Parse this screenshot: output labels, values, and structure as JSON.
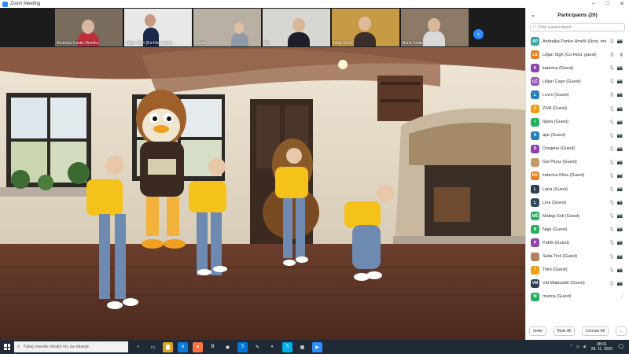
{
  "window": {
    "title": "Zoom Meeting",
    "controls": [
      "–",
      "□",
      "✕"
    ]
  },
  "gallery": {
    "tiles": [
      {
        "name": "Andrejka Fanko Hmelko"
      },
      {
        "name": "Lilijan Sigh (Ko-Host, gues..."
      },
      {
        "name": "Lumbi"
      },
      {
        "name": "Zia"
      },
      {
        "name": "Maja Skok"
      },
      {
        "name": "Boris Tovak"
      }
    ],
    "next_icon": "›"
  },
  "panel": {
    "title": "Participants (20)",
    "collapse_icon": "⌄",
    "search_placeholder": "Find a participant",
    "participants": [
      {
        "initials": "AP",
        "name": "Andrejka Panko Hmelk (Host, me)",
        "color": "#3aa39a",
        "mic": "🎙",
        "cam": "📷"
      },
      {
        "initials": "LS",
        "name": "Lilijan Sigh (Co-Host, guest)",
        "color": "#e67e22",
        "mic": "🎙",
        "cam": "▮"
      },
      {
        "initials": "K",
        "name": "katarina (Guest)",
        "color": "#8e44ad",
        "mic": "🎙",
        "cam": "📷"
      },
      {
        "initials": "LČ",
        "name": "Lilijan Čapo (Guest)",
        "color": "#9b59b6",
        "mic": "🎙",
        "cam": "📷"
      },
      {
        "initials": "L",
        "name": "Lovro (Guest)",
        "color": "#2980b9",
        "mic": "🎙",
        "cam": "📷"
      },
      {
        "initials": "Z",
        "name": "ZiVA (Guest)",
        "color": "#f39c12",
        "mic": "🎙",
        "cam": "📷"
      },
      {
        "initials": "I",
        "name": "Iljada (Guest)",
        "color": "#27ae60",
        "mic": "🎙",
        "cam": "📷"
      },
      {
        "initials": "A",
        "name": "ajar (Guest)",
        "color": "#2980b9",
        "mic": "🎙",
        "cam": "📷"
      },
      {
        "initials": "D",
        "name": "Dragana (Guest)",
        "color": "#8e44ad",
        "mic": "🎙",
        "cam": "📷"
      },
      {
        "initials": "",
        "name": "Gal Plunz (Guest)",
        "color": "#c49a6c",
        "mic": "🎙",
        "cam": "📷"
      },
      {
        "initials": "KK",
        "name": "katarina Kline (Guest)",
        "color": "#e67e22",
        "mic": "🎙",
        "cam": "📷"
      },
      {
        "initials": "L",
        "name": "Lana (Guest)",
        "color": "#2c3e50",
        "mic": "🎙",
        "cam": "📷"
      },
      {
        "initials": "L",
        "name": "Lina (Guest)",
        "color": "#34495e",
        "mic": "🎙",
        "cam": "📷"
      },
      {
        "initials": "MŠ",
        "name": "Mateja Šoli (Guest)",
        "color": "#27ae60",
        "mic": "🎙",
        "cam": "📷"
      },
      {
        "initials": "N",
        "name": "Naja (Guest)",
        "color": "#27ae60",
        "mic": "🎙",
        "cam": "📷"
      },
      {
        "initials": "P",
        "name": "Patrik (Guest)",
        "color": "#8e44ad",
        "mic": "🎙",
        "cam": "📷"
      },
      {
        "initials": "",
        "name": "Saša Tinš (Guest)",
        "color": "#b08060",
        "mic": "🎙",
        "cam": "📷"
      },
      {
        "initials": "T",
        "name": "Tilen (Guest)",
        "color": "#f39c12",
        "mic": "🎙",
        "cam": "📷"
      },
      {
        "initials": "VM",
        "name": "Vid Malavašič (Guest)",
        "color": "#2c3e50",
        "mic": "🎙",
        "cam": "📷"
      },
      {
        "initials": "M",
        "name": "manca (Guest)",
        "color": "#27ae60",
        "mic": "",
        "cam": "⁄"
      }
    ],
    "footer": {
      "invite": "Invite",
      "mute_all": "Mute All",
      "unmute_all": "Unmute All",
      "more": "..."
    }
  },
  "taskbar": {
    "search_placeholder": "Tukaj vnesite iskalni niz za iskanje",
    "search_icon": "⌕",
    "apps": [
      {
        "icon": "task-view-icon",
        "glyph": "○",
        "color": "transparent"
      },
      {
        "icon": "task-switch-icon",
        "glyph": "▭",
        "color": "transparent"
      },
      {
        "icon": "explorer-icon",
        "glyph": "▇",
        "color": "#d9a420"
      },
      {
        "icon": "edge-icon",
        "glyph": "e",
        "color": "#0f7bd6"
      },
      {
        "icon": "firefox-icon",
        "glyph": "●",
        "color": "#ff7139"
      },
      {
        "icon": "brave-icon",
        "glyph": "B",
        "color": "#1f2a36"
      },
      {
        "icon": "chrome-icon",
        "glyph": "◉",
        "color": "#1f2a36"
      },
      {
        "icon": "skype-icon",
        "glyph": "S",
        "color": "#0078d4"
      },
      {
        "icon": "paint-icon",
        "glyph": "✎",
        "color": "#1f2a36"
      },
      {
        "icon": "edge-new-icon",
        "glyph": "◐",
        "color": "#1f2a36"
      },
      {
        "icon": "skype2-icon",
        "glyph": "S",
        "color": "#00aff0"
      },
      {
        "icon": "store-icon",
        "glyph": "▦",
        "color": "#1f2a36"
      },
      {
        "icon": "zoom-icon",
        "glyph": "▶",
        "color": "#2d8cff"
      }
    ],
    "time": "08:01",
    "date": "28. 11. 2020",
    "notification_icon": "🗨"
  }
}
